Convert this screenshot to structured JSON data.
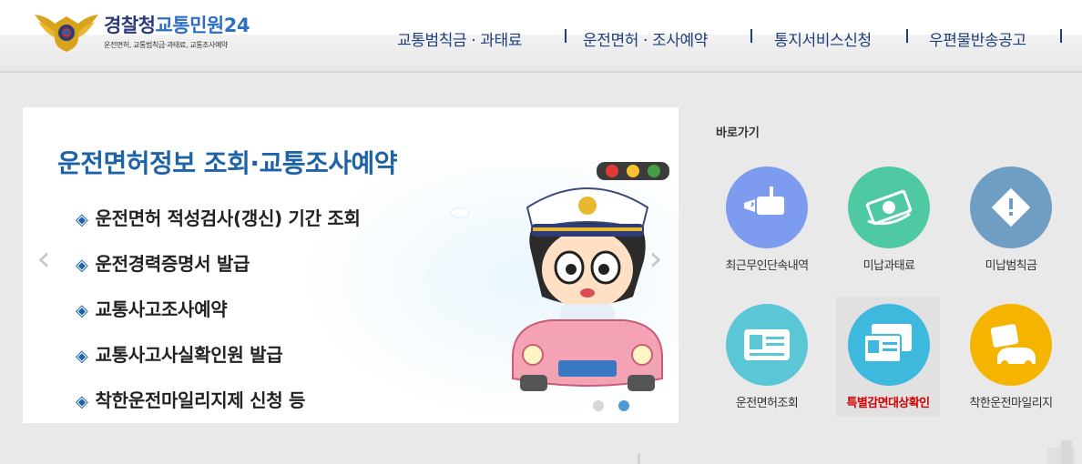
{
  "header": {
    "logo_title_part1": "경찰청",
    "logo_title_part2": "교통민원24",
    "logo_subtitle": "운전면허, 교통범칙금·과태료, 교통조사예약",
    "emblem_icon": "police-emblem-icon"
  },
  "nav": {
    "items": [
      "교통범칙금 · 과태료",
      "운전면허 · 조사예약",
      "통지서비스신청",
      "우편물반송공고"
    ]
  },
  "banner": {
    "title": "운전면허정보 조회·교통조사예약",
    "bullets": [
      "운전면허 적성검사(갱신) 기간 조회",
      "운전경력증명서 발급",
      "교통사고조사예약",
      "교통사고사실확인원 발급",
      "착한운전마일리지제 신청 등"
    ],
    "bullet_marker": "◈",
    "prev_arrow": "‹",
    "next_arrow": "›",
    "slide_count": 2,
    "active_slide": 2
  },
  "quick": {
    "title": "바로가기",
    "items": [
      {
        "label": "최근무인단속내역",
        "icon": "speed-camera-icon",
        "color": "#7d9cf0"
      },
      {
        "label": "미납과태료",
        "icon": "money-bill-icon",
        "color": "#4fc9a4"
      },
      {
        "label": "미납범칙금",
        "icon": "warning-sign-icon",
        "color": "#6f9ec5"
      },
      {
        "label": "운전면허조회",
        "icon": "license-card-icon",
        "color": "#5bc7d6"
      },
      {
        "label": "특별감면대상확인",
        "icon": "id-documents-icon",
        "color": "#3fb8de"
      },
      {
        "label": "착한운전마일리지",
        "icon": "mileage-car-icon",
        "color": "#f5b400"
      }
    ]
  },
  "colors": {
    "brand_navy": "#2f3b77",
    "brand_blue": "#2f6fc3",
    "title_blue": "#1e63a7",
    "highlight_red": "#d40000"
  }
}
